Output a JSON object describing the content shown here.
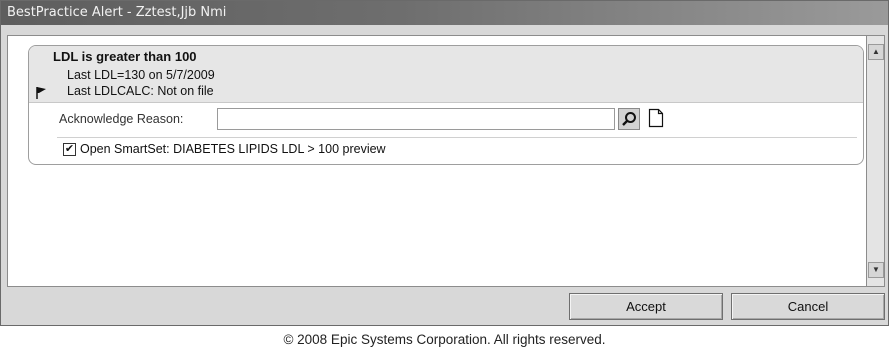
{
  "window": {
    "title": "BestPractice Alert - Zztest,Jjb Nmi"
  },
  "alert": {
    "title": "LDL is greater than 100",
    "line1": "Last LDL=130 on 5/7/2009",
    "line2": "Last LDLCALC: Not on file"
  },
  "acknowledge": {
    "label": "Acknowledge Reason:",
    "value": ""
  },
  "smartset": {
    "checked": true,
    "label": "Open SmartSet: DIABETES LIPIDS LDL > 100 preview"
  },
  "buttons": {
    "accept_label": "Accept",
    "cancel_label": "Cancel"
  },
  "footer": {
    "copyright": "© 2008 Epic Systems Corporation.  All rights reserved."
  },
  "icons": {
    "flag": "flag-icon",
    "search": "search-icon",
    "document": "document-icon",
    "scroll_up": "arrow-up-icon",
    "scroll_down": "arrow-down-icon",
    "check": "checkmark-icon"
  }
}
